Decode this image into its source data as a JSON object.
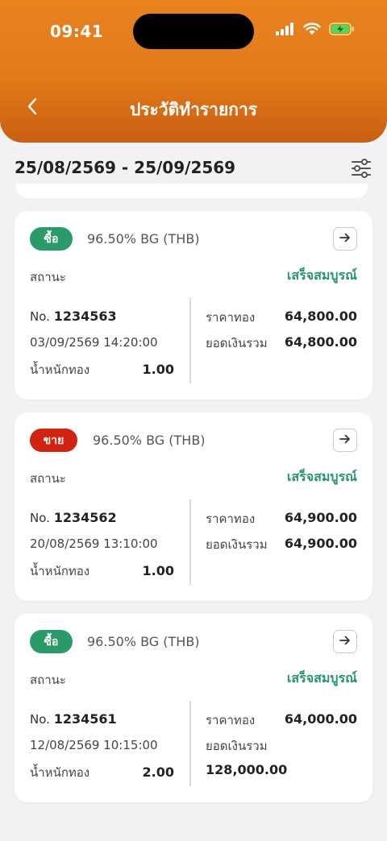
{
  "status_bar": {
    "time": "09:41"
  },
  "header": {
    "title": "ประวัติทำรายการ"
  },
  "date_range": "25/08/2569 - 25/09/2569",
  "colors": {
    "accent": "#e27a1a",
    "buy": "#2a9a6a",
    "sell": "#d1230f",
    "success": "#27966a"
  },
  "transactions": [
    {
      "type": "ซื้อ",
      "type_color": "#2a9a6a",
      "product": "96.50% BG (THB)",
      "status_label": "สถานะ",
      "status": "เสร็จสมบูรณ์",
      "no_label": "No.",
      "no": "1234563",
      "datetime": "03/09/2569 14:20:00",
      "weight_label": "น้ำหนักทอง",
      "weight": "1.00",
      "price_label": "ราคาทอง",
      "price": "64,800.00",
      "total_label": "ยอดเงินรวม",
      "total": "64,800.00"
    },
    {
      "type": "ขาย",
      "type_color": "#d1230f",
      "product": "96.50% BG (THB)",
      "status_label": "สถานะ",
      "status": "เสร็จสมบูรณ์",
      "no_label": "No.",
      "no": "1234562",
      "datetime": "20/08/2569 13:10:00",
      "weight_label": "น้ำหนักทอง",
      "weight": "1.00",
      "price_label": "ราคาทอง",
      "price": "64,900.00",
      "total_label": "ยอดเงินรวม",
      "total": "64,900.00"
    },
    {
      "type": "ซื้อ",
      "type_color": "#2a9a6a",
      "product": "96.50% BG (THB)",
      "status_label": "สถานะ",
      "status": "เสร็จสมบูรณ์",
      "no_label": "No.",
      "no": "1234561",
      "datetime": "12/08/2569 10:15:00",
      "weight_label": "น้ำหนักทอง",
      "weight": "2.00",
      "price_label": "ราคาทอง",
      "price": "64,000.00",
      "total_label": "ยอดเงินรวม",
      "total": "128,000.00"
    }
  ],
  "icons": {
    "back": "chevron-left-icon",
    "filter": "sliders-icon",
    "open": "arrow-right-icon",
    "signal": "signal-icon",
    "wifi": "wifi-icon",
    "battery": "battery-charging-icon"
  }
}
